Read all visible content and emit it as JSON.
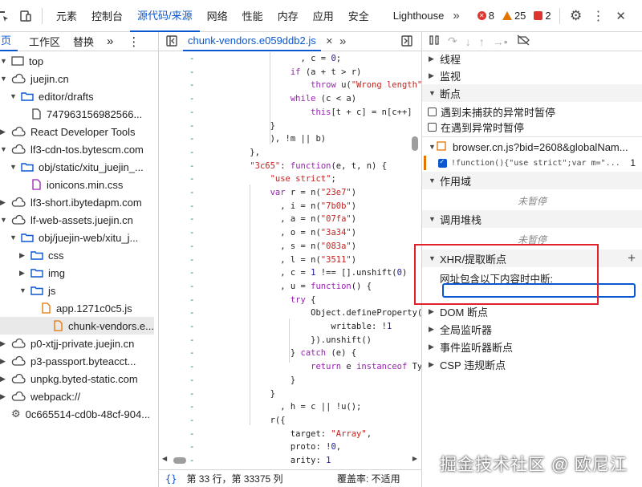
{
  "toolbar": {
    "tabs": [
      "元素",
      "控制台",
      "源代码/来源",
      "网络",
      "性能",
      "内存",
      "应用",
      "安全",
      "Lighthouse"
    ],
    "active_tab": "源代码/来源",
    "errors": "8",
    "warnings": "25",
    "issues": "2"
  },
  "navigator": {
    "tabs": [
      "网页",
      "工作区",
      "替换"
    ],
    "tree": [
      {
        "label": "top",
        "icon": "frame-icon",
        "expanded": true
      },
      {
        "label": "juejin.cn",
        "icon": "cloud-icon",
        "expanded": true
      },
      {
        "label": "editor/drafts",
        "icon": "folder-icon",
        "expanded": true
      },
      {
        "label": "747963156982566...",
        "icon": "file-icon"
      },
      {
        "label": "React Developer Tools",
        "icon": "cloud-icon",
        "expanded": false
      },
      {
        "label": "lf3-cdn-tos.bytescm.com",
        "icon": "cloud-icon",
        "expanded": true
      },
      {
        "label": "obj/static/xitu_juejin_...",
        "icon": "folder-icon",
        "expanded": true
      },
      {
        "label": "ionicons.min.css",
        "icon": "css-file-icon"
      },
      {
        "label": "lf3-short.ibytedapm.com",
        "icon": "cloud-icon",
        "expanded": false
      },
      {
        "label": "lf-web-assets.juejin.cn",
        "icon": "cloud-icon",
        "expanded": true
      },
      {
        "label": "obj/juejin-web/xitu_j...",
        "icon": "folder-icon",
        "expanded": true
      },
      {
        "label": "css",
        "icon": "folder-icon",
        "expanded": false
      },
      {
        "label": "img",
        "icon": "folder-icon",
        "expanded": false
      },
      {
        "label": "js",
        "icon": "folder-icon",
        "expanded": true
      },
      {
        "label": "app.1271c0c5.js",
        "icon": "js-file-icon"
      },
      {
        "label": "chunk-vendors.e...",
        "icon": "js-file-icon",
        "selected": true
      },
      {
        "label": "p0-xtjj-private.juejin.cn",
        "icon": "cloud-icon",
        "expanded": false
      },
      {
        "label": "p3-passport.byteacct...",
        "icon": "cloud-icon",
        "expanded": false
      },
      {
        "label": "unpkg.byted-static.com",
        "icon": "cloud-icon",
        "expanded": false
      },
      {
        "label": "webpack://",
        "icon": "cloud-icon",
        "expanded": false
      },
      {
        "label": "0c665514-cd0b-48cf-904...",
        "icon": "gear-icon"
      }
    ]
  },
  "editor": {
    "file_tab": "chunk-vendors.e059ddb2.js",
    "status_position": "第 33 行，第 33375 列",
    "coverage": "覆盖率: 不适用",
    "code_lines": [
      "              , c = 0;",
      "            if (a + t > r)",
      "                throw u(\"Wrong length\");",
      "            while (c < a)",
      "                this[t + c] = n[c++]",
      "        }",
      "        ), !m || b)",
      "    },",
      "    \"3c65\": function(e, t, n) {",
      "        \"use strict\";",
      "        var r = n(\"23e7\")",
      "          , i = n(\"7b0b\")",
      "          , a = n(\"07fa\")",
      "          , o = n(\"3a34\")",
      "          , s = n(\"083a\")",
      "          , l = n(\"3511\")",
      "          , c = 1 !== [].unshift(0)",
      "          , u = function() {",
      "            try {",
      "                Object.defineProperty([],",
      "                    writable: !1",
      "                }).unshift()",
      "            } catch (e) {",
      "                return e instanceof TypeE",
      "            }",
      "        }",
      "          , h = c || !u();",
      "        r({",
      "            target: \"Array\",",
      "            proto: !0,",
      "            arity: 1"
    ]
  },
  "debugger": {
    "threads": "线程",
    "watch": "监视",
    "breakpoints": "断点",
    "pause_uncaught": "遇到未捕获的异常时暂停",
    "pause_caught": "在遇到异常时暂停",
    "bp_file": "browser.cn.js?bid=2608&globalNam...",
    "bp_code": "!function(){\"use strict\";var m=\"...",
    "bp_line": "1",
    "scope": "作用域",
    "not_paused_1": "未暂停",
    "call_stack": "调用堆栈",
    "not_paused_2": "未暂停",
    "xhr": "XHR/提取断点",
    "xhr_label": "网址包含以下内容时中断:",
    "xhr_input": "",
    "dom": "DOM 断点",
    "global": "全局监听器",
    "event": "事件监听器断点",
    "csp": "CSP 违规断点"
  },
  "watermark": "掘金技术社区 @ 欧尼江"
}
